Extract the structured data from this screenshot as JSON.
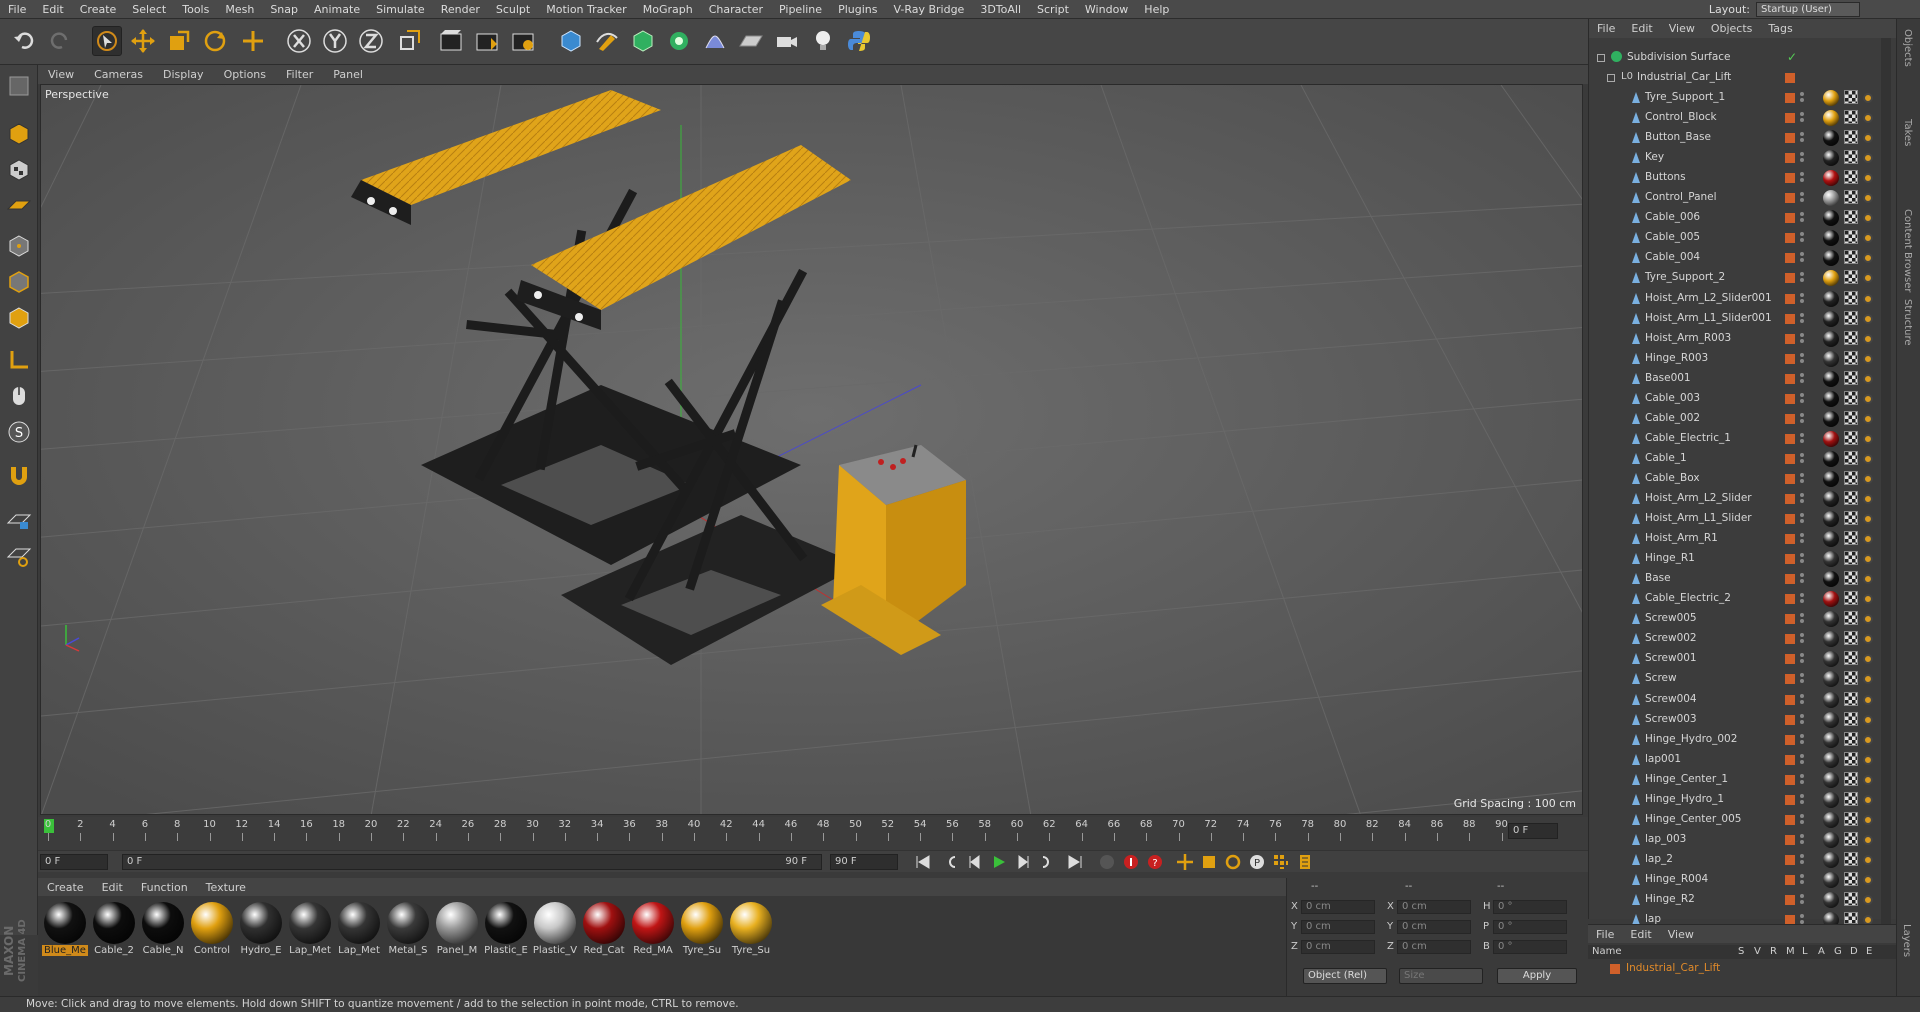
{
  "menubar": [
    "File",
    "Edit",
    "Create",
    "Select",
    "Tools",
    "Mesh",
    "Snap",
    "Animate",
    "Simulate",
    "Render",
    "Sculpt",
    "Motion Tracker",
    "MoGraph",
    "Character",
    "Pipeline",
    "Plugins",
    "V-Ray Bridge",
    "3DToAll",
    "Script",
    "Window",
    "Help"
  ],
  "layout": {
    "label": "Layout:",
    "value": "Startup (User)"
  },
  "viewport": {
    "menu": [
      "View",
      "Cameras",
      "Display",
      "Options",
      "Filter",
      "Panel"
    ],
    "camera_label": "Perspective",
    "grid_spacing": "Grid Spacing : 100 cm"
  },
  "timeline": {
    "ticks": [
      "0",
      "2",
      "4",
      "6",
      "8",
      "10",
      "12",
      "14",
      "16",
      "18",
      "20",
      "22",
      "24",
      "26",
      "28",
      "30",
      "32",
      "34",
      "36",
      "38",
      "40",
      "42",
      "44",
      "46",
      "48",
      "50",
      "52",
      "54",
      "56",
      "58",
      "60",
      "62",
      "64",
      "66",
      "68",
      "70",
      "72",
      "74",
      "76",
      "78",
      "80",
      "82",
      "84",
      "86",
      "88",
      "90"
    ],
    "current_frame": "0 F",
    "start_field": "0 F",
    "range_start": "0 F",
    "range_end": "90 F",
    "end_field": "90 F",
    "right_field": "0 F"
  },
  "material_manager": {
    "menu": [
      "Create",
      "Edit",
      "Function",
      "Texture"
    ],
    "materials": [
      {
        "name": "Blue_Me",
        "color": "#111111",
        "selected": true
      },
      {
        "name": "Cable_2",
        "color": "#0d0d0d"
      },
      {
        "name": "Cable_N",
        "color": "#0d0d0d"
      },
      {
        "name": "Control",
        "color": "#e0a010"
      },
      {
        "name": "Hydro_E",
        "color": "#303030"
      },
      {
        "name": "Lap_Met",
        "color": "#353535"
      },
      {
        "name": "Lap_Met",
        "color": "#353535"
      },
      {
        "name": "Metal_S",
        "color": "#3a3a3a"
      },
      {
        "name": "Panel_M",
        "color": "#9a9a9a"
      },
      {
        "name": "Plastic_E",
        "color": "#111111"
      },
      {
        "name": "Plastic_V",
        "color": "#c8c8c8"
      },
      {
        "name": "Red_Cat",
        "color": "#a01010"
      },
      {
        "name": "Red_MA",
        "color": "#c01515"
      },
      {
        "name": "Tyre_Su",
        "color": "#e0a010"
      },
      {
        "name": "Tyre_Su",
        "color": "#e8b020"
      }
    ]
  },
  "coords": {
    "header": [
      "--",
      "--",
      "--"
    ],
    "rows": [
      {
        "a": "X",
        "av": "0 cm",
        "b": "X",
        "bv": "0 cm",
        "c": "H",
        "cv": "0 °"
      },
      {
        "a": "Y",
        "av": "0 cm",
        "b": "Y",
        "bv": "0 cm",
        "c": "P",
        "cv": "0 °"
      },
      {
        "a": "Z",
        "av": "0 cm",
        "b": "Z",
        "bv": "0 cm",
        "c": "B",
        "cv": "0 °"
      }
    ],
    "mode": "Object (Rel)",
    "size": "Size",
    "apply": "Apply"
  },
  "object_manager": {
    "menu": [
      "File",
      "Edit",
      "View",
      "Objects",
      "Tags"
    ],
    "root": "Subdivision Surface",
    "group": "Industrial_Car_Lift",
    "objects": [
      {
        "name": "Tyre_Support_1",
        "tag": "#e0a010"
      },
      {
        "name": "Control_Block",
        "tag": "#e0a010"
      },
      {
        "name": "Button_Base",
        "tag": "#111111"
      },
      {
        "name": "Key",
        "tag": "#222222"
      },
      {
        "name": "Buttons",
        "tag": "#b01010"
      },
      {
        "name": "Control_Panel",
        "tag": "#999999"
      },
      {
        "name": "Cable_006",
        "tag": "#111111"
      },
      {
        "name": "Cable_005",
        "tag": "#111111"
      },
      {
        "name": "Cable_004",
        "tag": "#111111"
      },
      {
        "name": "Tyre_Support_2",
        "tag": "#e0a010"
      },
      {
        "name": "Hoist_Arm_L2_Slider001",
        "tag": "#222222"
      },
      {
        "name": "Hoist_Arm_L1_Slider001",
        "tag": "#222222"
      },
      {
        "name": "Hoist_Arm_R003",
        "tag": "#222222"
      },
      {
        "name": "Hinge_R003",
        "tag": "#333333"
      },
      {
        "name": "Base001",
        "tag": "#111111"
      },
      {
        "name": "Cable_003",
        "tag": "#111111"
      },
      {
        "name": "Cable_002",
        "tag": "#111111"
      },
      {
        "name": "Cable_Electric_1",
        "tag": "#a01010"
      },
      {
        "name": "Cable_1",
        "tag": "#111111"
      },
      {
        "name": "Cable_Box",
        "tag": "#111111"
      },
      {
        "name": "Hoist_Arm_L2_Slider",
        "tag": "#222222"
      },
      {
        "name": "Hoist_Arm_L1_Slider",
        "tag": "#222222"
      },
      {
        "name": "Hoist_Arm_R1",
        "tag": "#222222"
      },
      {
        "name": "Hinge_R1",
        "tag": "#333333"
      },
      {
        "name": "Base",
        "tag": "#111111"
      },
      {
        "name": "Cable_Electric_2",
        "tag": "#a01010"
      },
      {
        "name": "Screw005",
        "tag": "#333333"
      },
      {
        "name": "Screw002",
        "tag": "#333333"
      },
      {
        "name": "Screw001",
        "tag": "#333333"
      },
      {
        "name": "Screw",
        "tag": "#333333"
      },
      {
        "name": "Screw004",
        "tag": "#333333"
      },
      {
        "name": "Screw003",
        "tag": "#333333"
      },
      {
        "name": "Hinge_Hydro_002",
        "tag": "#333333"
      },
      {
        "name": "lap001",
        "tag": "#333333"
      },
      {
        "name": "Hinge_Center_1",
        "tag": "#333333"
      },
      {
        "name": "Hinge_Hydro_1",
        "tag": "#333333"
      },
      {
        "name": "Hinge_Center_005",
        "tag": "#333333"
      },
      {
        "name": "lap_003",
        "tag": "#333333"
      },
      {
        "name": "lap_2",
        "tag": "#333333"
      },
      {
        "name": "Hinge_R004",
        "tag": "#333333"
      },
      {
        "name": "Hinge_R2",
        "tag": "#333333"
      },
      {
        "name": "lap",
        "tag": "#333333"
      }
    ]
  },
  "side_tabs": [
    "Objects",
    "Takes",
    "Content Browser",
    "Structure"
  ],
  "layers": {
    "menu": [
      "File",
      "Edit",
      "View"
    ],
    "columns": {
      "name": "Name",
      "flags": [
        "S",
        "V",
        "R",
        "M",
        "L",
        "A",
        "G",
        "D",
        "E"
      ]
    },
    "row": "Industrial_Car_Lift",
    "side_tab": "Layers"
  },
  "branding": {
    "line1": "MAXON",
    "line2": "CINEMA 4D"
  },
  "status": "Move: Click and drag to move elements. Hold down SHIFT to quantize movement / add to the selection in point mode, CTRL to remove."
}
